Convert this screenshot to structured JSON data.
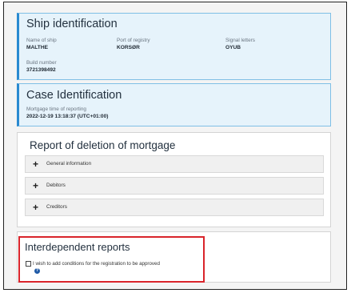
{
  "ship_identification": {
    "title": "Ship identification",
    "fields": [
      {
        "label": "Name of ship",
        "value": "MALTHE"
      },
      {
        "label": "Port of registry",
        "value": "KORSØR"
      },
      {
        "label": "Signal letters",
        "value": "OYUB"
      },
      {
        "label": "Build number",
        "value": "3721398492"
      }
    ]
  },
  "case_identification": {
    "title": "Case Identification",
    "fields": [
      {
        "label": "Mortgage time of reporting",
        "value": "2022-12-19 13:18:37 (UTC+01:00)"
      }
    ]
  },
  "report": {
    "title": "Report of deletion of mortgage",
    "sections": [
      {
        "icon": "plus-icon",
        "symbol": "+",
        "label": "General information"
      },
      {
        "icon": "plus-icon",
        "symbol": "+",
        "label": "Debitors"
      },
      {
        "icon": "plus-icon",
        "symbol": "+",
        "label": "Creditors"
      }
    ]
  },
  "interdependent": {
    "title": "Interdependent reports",
    "checkbox_label": "I wish to add conditions for the registration to be approved",
    "help_symbol": "?",
    "highlight_color": "#d9242b"
  }
}
